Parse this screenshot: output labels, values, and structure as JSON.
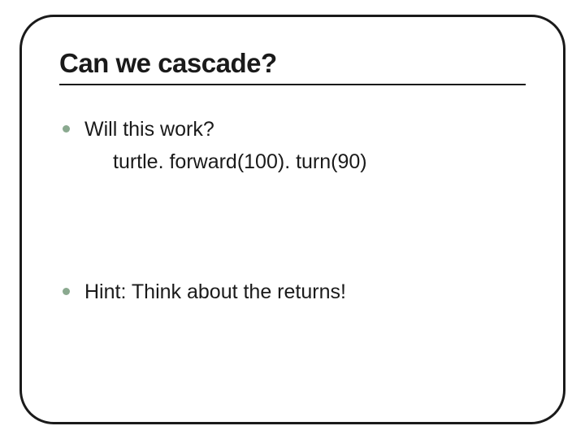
{
  "slide": {
    "title": "Can we cascade?",
    "bullets": [
      {
        "text": "Will this work?",
        "code": "turtle. forward(100). turn(90)"
      },
      {
        "text": "Hint: Think about the returns!"
      }
    ]
  }
}
